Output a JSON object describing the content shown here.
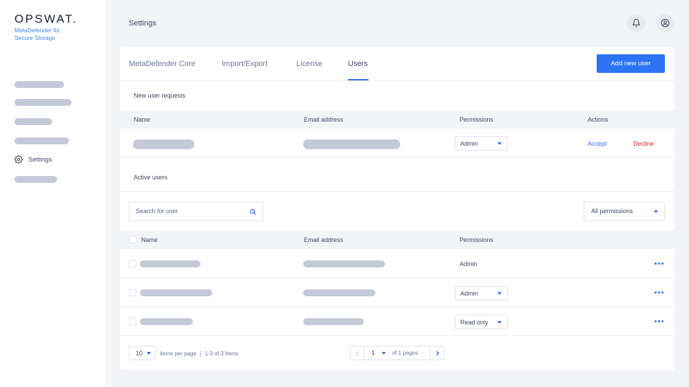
{
  "brand": {
    "logo": "OPSWAT.",
    "product_line1": "MetaDefender for",
    "product_line2": "Secure Storage"
  },
  "sidebar": {
    "items": [
      {
        "label": "",
        "placeholder": true
      },
      {
        "label": "",
        "placeholder": true
      },
      {
        "label": "",
        "placeholder": true
      },
      {
        "label": "",
        "placeholder": true
      },
      {
        "label": "Settings",
        "icon": "gear-icon",
        "active": true
      },
      {
        "label": "",
        "placeholder": true
      }
    ]
  },
  "header": {
    "title": "Settings",
    "icons": [
      "bell-icon",
      "user-circle-icon"
    ]
  },
  "tabs": [
    {
      "label": "MetaDefender Core",
      "active": false
    },
    {
      "label": "Import/Export",
      "active": false
    },
    {
      "label": "License",
      "active": false
    },
    {
      "label": "Users",
      "active": true
    }
  ],
  "add_user_button": "Add new user",
  "new_requests": {
    "title": "New user requests",
    "columns": [
      "Name",
      "Email address",
      "Permissions",
      "Actions"
    ],
    "rows": [
      {
        "permission": "Admin",
        "accept": "Accept",
        "decline": "Decline"
      }
    ]
  },
  "active_users": {
    "title": "Active users",
    "search_placeholder": "Search for user",
    "filter_value": "All permissions",
    "columns": [
      "Name",
      "Email address",
      "Permissions"
    ],
    "rows": [
      {
        "permission": "Admin",
        "editable": false
      },
      {
        "permission": "Admin",
        "editable": true
      },
      {
        "permission": "Read only",
        "editable": true
      }
    ]
  },
  "pagination": {
    "per_page": "10",
    "per_page_label": "items per page",
    "separator": "|",
    "range_label": "1-3 of 3 items",
    "current_page": "1",
    "pages_label": "of 1 pages"
  },
  "colors": {
    "accent": "#2d74f5",
    "accept": "#2d6ff0",
    "decline": "#e0202a",
    "placeholder_bar": "#c4c9d8"
  }
}
